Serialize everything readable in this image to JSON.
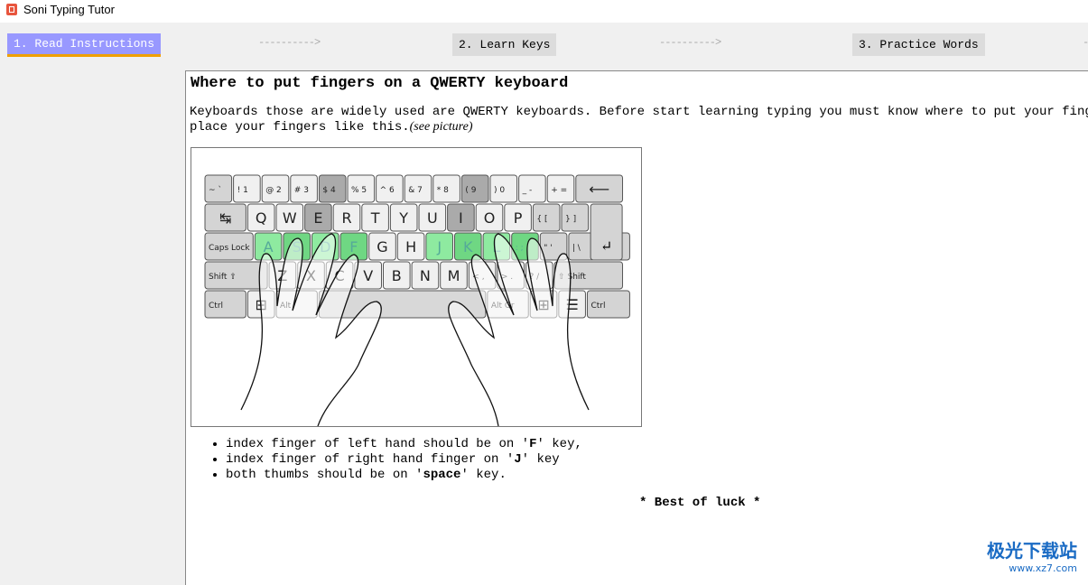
{
  "window": {
    "title": "Soni Typing Tutor"
  },
  "steps": [
    {
      "label": "1. Read Instructions",
      "active": true
    },
    {
      "label": "2. Learn Keys"
    },
    {
      "label": "3. Practice Words"
    }
  ],
  "arrow": "---------->",
  "content": {
    "heading": "Where to put fingers on a QWERTY keyboard",
    "intro_line1": "Keyboards those are widely used are QWERTY keyboards. Before start learning typing you must know where to put your fingers.",
    "intro_line2": "place your fingers like this.",
    "intro_see": "(see picture)",
    "bullets": [
      {
        "pre": "index finger of left hand should be on '",
        "key": "F",
        "post": "' key,"
      },
      {
        "pre": "index finger of right hand finger on '",
        "key": "J",
        "post": "' key"
      },
      {
        "pre": "both thumbs should be on '",
        "key": "space",
        "post": "' key."
      }
    ],
    "closing": "* Best of luck *"
  },
  "picture": {
    "rows": [
      [
        "~ `",
        "! 1",
        "@ 2",
        "# 3",
        "$ 4",
        "% 5",
        "^ 6",
        "& 7",
        "* 8",
        "( 9",
        ") 0",
        "_ -",
        "+ =",
        "⟵"
      ],
      [
        "↹",
        "Q",
        "W",
        "E",
        "R",
        "T",
        "Y",
        "U",
        "I",
        "O",
        "P",
        "{ [",
        "} ]"
      ],
      [
        "Caps Lock",
        "A",
        "S",
        "D",
        "F",
        "G",
        "H",
        "J",
        "K",
        "L",
        ": ;",
        "\" '",
        "| \\",
        "↵"
      ],
      [
        "Shift ⇧",
        "Z",
        "X",
        "C",
        "V",
        "B",
        "N",
        "M",
        "< ,",
        "> .",
        "? /",
        "⇧ Shift"
      ],
      [
        "Ctrl",
        "⊞",
        "Alt",
        "",
        "Alt Gr",
        "⊞",
        "☰",
        "Ctrl"
      ]
    ],
    "colors": {
      "home_row": "#8eeaa0",
      "home_dark": "#6fd783",
      "dark_key": "#aaaaaa",
      "key": "#f0f0f0",
      "mod_key": "#d4d4d4"
    }
  },
  "watermark": {
    "text": "极光下载站",
    "url": "www.xz7.com"
  }
}
